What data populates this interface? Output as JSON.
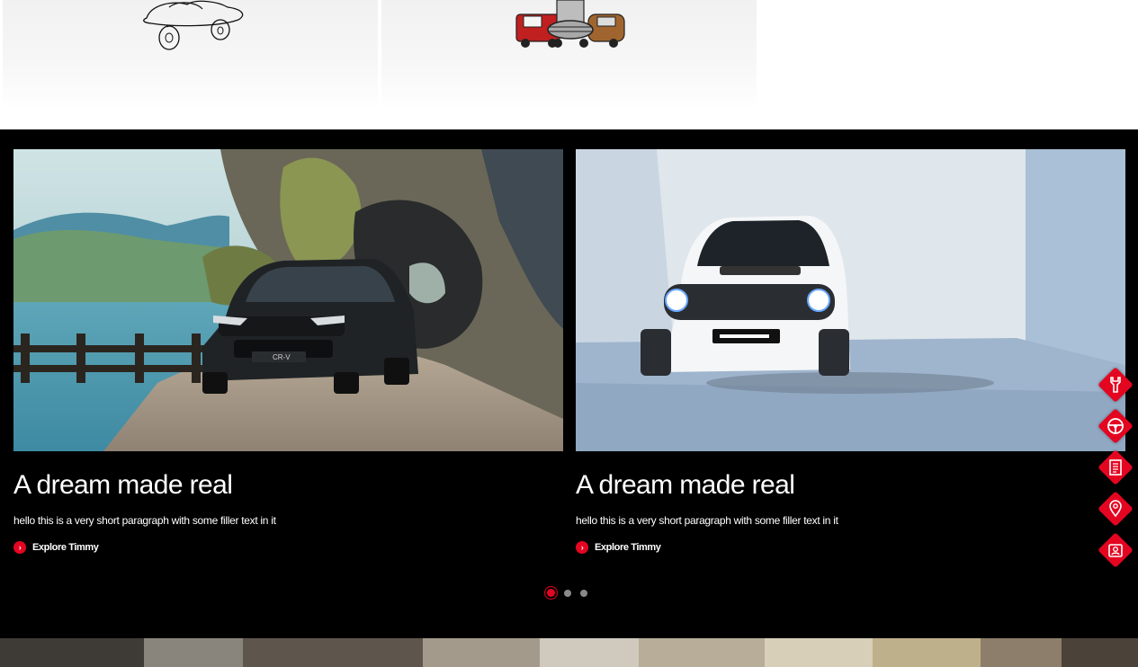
{
  "top_cards": [
    {
      "icon": "car-sketch-icon"
    },
    {
      "icon": "car-group-icon"
    }
  ],
  "slides": [
    {
      "title": "A dream made real",
      "text": "hello this is a very short paragraph with some filler text in it",
      "link_label": "Explore Timmy",
      "image": "dark-suv-tunnel-painting"
    },
    {
      "title": "A dream made real",
      "text": "hello this is a very short paragraph with some filler text in it",
      "link_label": "Explore Timmy",
      "image": "white-compact-car-painting"
    }
  ],
  "pagination": {
    "count": 3,
    "active_index": 0
  },
  "side_nav": [
    {
      "icon": "wrench-icon"
    },
    {
      "icon": "steering-wheel-icon"
    },
    {
      "icon": "brochure-icon"
    },
    {
      "icon": "location-pin-icon"
    },
    {
      "icon": "contact-card-icon"
    }
  ],
  "colors": {
    "accent": "#e40521",
    "background_dark": "#000000",
    "text_light": "#ffffff"
  }
}
